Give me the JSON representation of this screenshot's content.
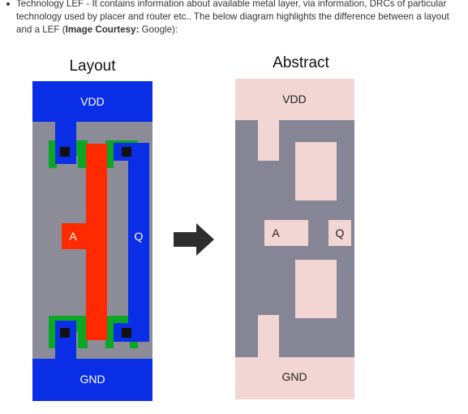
{
  "paragraph": {
    "part1": "Technology LEF - It contains information about available metal layer, via information, DRCs of particular technology used by placer and router etc.. The below diagram highlights the difference between a layout and a LEF (",
    "bold": "Image Courtesy:",
    "part2": " Google):"
  },
  "figure": {
    "layout_title": "Layout",
    "abstract_title": "Abstract",
    "layout_labels": {
      "vdd": "VDD",
      "gnd": "GND",
      "a": "A",
      "q": "Q"
    },
    "abstract_labels": {
      "vdd": "VDD",
      "gnd": "GND",
      "a": "A",
      "q": "Q"
    },
    "arrow_icon": "right-arrow-icon",
    "colors": {
      "metal_blue": "#0a2ee6",
      "poly_red": "#ff2a00",
      "diffusion_green": "#0aa626",
      "contact_black": "#111111",
      "substrate_gray": "#8c8c99",
      "abstract_pink": "#f2d6d3",
      "abstract_gray": "#868596",
      "arrow": "#2e2e2e"
    }
  }
}
